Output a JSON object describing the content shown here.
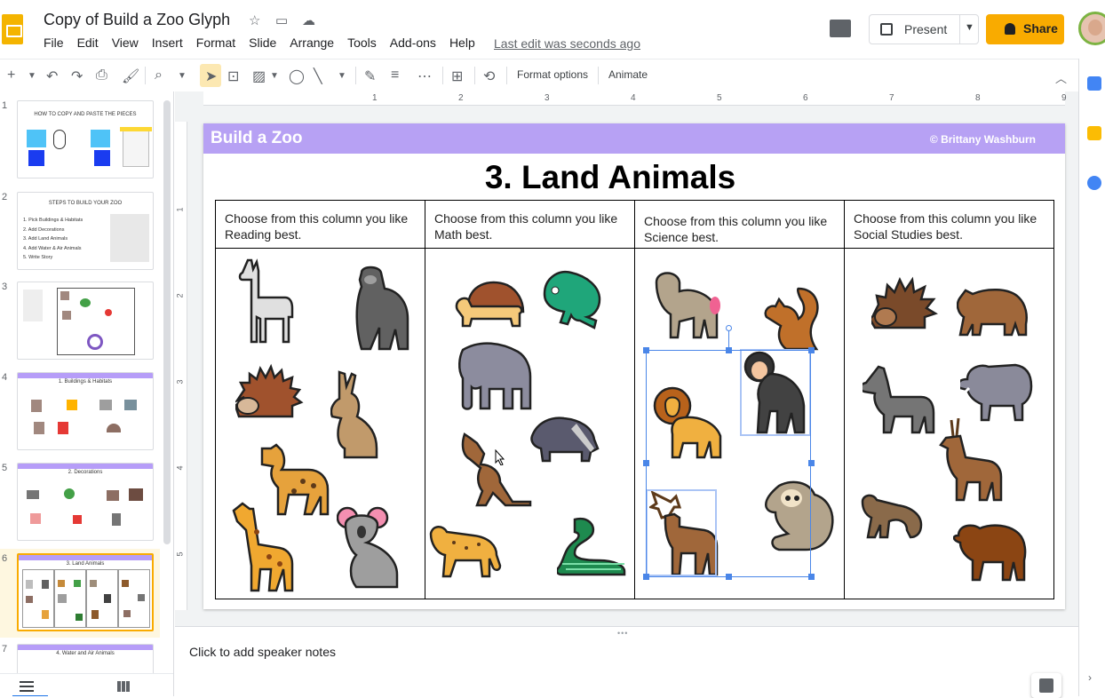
{
  "header": {
    "doc_title": "Copy of Build a Zoo Glyph",
    "menus": [
      "File",
      "Edit",
      "View",
      "Insert",
      "Format",
      "Slide",
      "Arrange",
      "Tools",
      "Add-ons",
      "Help"
    ],
    "last_edit": "Last edit was seconds ago",
    "present_label": "Present",
    "share_label": "Share"
  },
  "toolbar": {
    "format_options": "Format options",
    "animate": "Animate"
  },
  "filmstrip": {
    "slides": [
      {
        "num": "1",
        "caption": "HOW TO COPY AND PASTE THE PIECES"
      },
      {
        "num": "2",
        "caption": "STEPS TO BUILD YOUR ZOO"
      },
      {
        "num": "3",
        "caption": ""
      },
      {
        "num": "4",
        "caption": "1. Buildings & Habitats"
      },
      {
        "num": "5",
        "caption": "2. Decorations"
      },
      {
        "num": "6",
        "caption": "3. Land Animals"
      },
      {
        "num": "7",
        "caption": "4. Water and Air Animals"
      }
    ],
    "slide2_steps": [
      "1. Pick Buildings & Habitats",
      "2. Add Decorations",
      "3. Add Land Animals",
      "4. Add Water & Air Animals",
      "5. Write Story"
    ],
    "active_index": 5
  },
  "ruler": {
    "h_ticks": [
      "1",
      "2",
      "3",
      "4",
      "5",
      "6",
      "7",
      "8",
      "9"
    ],
    "v_ticks": [
      "1",
      "2",
      "3",
      "4",
      "5"
    ]
  },
  "slide": {
    "brand": "Build a Zoo",
    "credit": "© Brittany Washburn",
    "heading": "3. Land Animals",
    "columns": [
      {
        "header": "Choose from this column you like Reading best.",
        "animals": [
          "llama-icon",
          "gorilla-icon",
          "hedgehog-icon",
          "kangaroo-rabbit-icon",
          "hyena-icon",
          "giraffe-icon",
          "koala-icon"
        ]
      },
      {
        "header": "Choose from this column you like Math best.",
        "animals": [
          "tortoise-icon",
          "chameleon-icon",
          "elephant-icon",
          "badger-icon",
          "kangaroo-icon",
          "cheetah-icon",
          "snake-icon"
        ]
      },
      {
        "header": "Choose from this column you like Science best.",
        "animals": [
          "baboon-icon",
          "squirrel-icon",
          "lion-icon",
          "chimpanzee-icon",
          "deer-icon",
          "sloth-icon"
        ]
      },
      {
        "header": "Choose from this column you like Social Studies best.",
        "animals": [
          "porcupine-icon",
          "bear-icon",
          "horse-icon",
          "boar-icon",
          "antelope-icon",
          "ferret-icon",
          "bison-icon"
        ]
      }
    ]
  },
  "notes": {
    "placeholder": "Click to add speaker notes"
  }
}
